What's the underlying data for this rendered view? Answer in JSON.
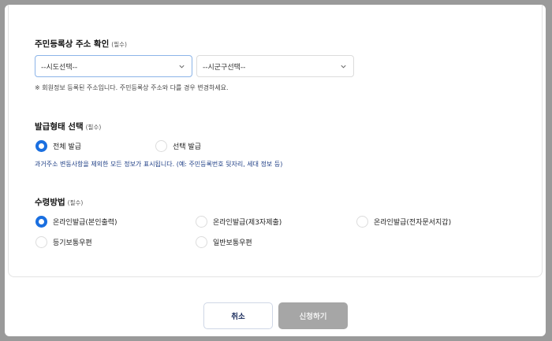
{
  "address": {
    "title": "주민등록상 주소 확인",
    "required": "(필수)",
    "sido_select": "--시도선택--",
    "sigungu_select": "--시군구선택--",
    "note": "※ 회원정보 등록된 주소입니다. 주민등록상 주소와 다를 경우 변경하세요."
  },
  "issue_type": {
    "title": "발급형태 선택",
    "required": "(필수)",
    "options": [
      {
        "label": "전체 발급",
        "checked": true
      },
      {
        "label": "선택 발급",
        "checked": false
      }
    ],
    "note": "과거주소 변동사항을 제외한 모든 정보가 표시됩니다. (예: 주민등록번호 뒷자리, 세대 정보 등)"
  },
  "receipt": {
    "title": "수령방법",
    "required": "(필수)",
    "options": [
      {
        "label": "온라인발급(본인출력)",
        "checked": true
      },
      {
        "label": "온라인발급(제3자제출)",
        "checked": false
      },
      {
        "label": "온라인발급(전자문서지갑)",
        "checked": false
      },
      {
        "label": "등기보통우편",
        "checked": false
      },
      {
        "label": "일반보통우편",
        "checked": false
      }
    ]
  },
  "buttons": {
    "cancel": "취소",
    "submit": "신청하기"
  },
  "colors": {
    "accent": "#1a6fe0",
    "note_blue": "#1f3f86",
    "submit_disabled": "#a6a6a6"
  }
}
